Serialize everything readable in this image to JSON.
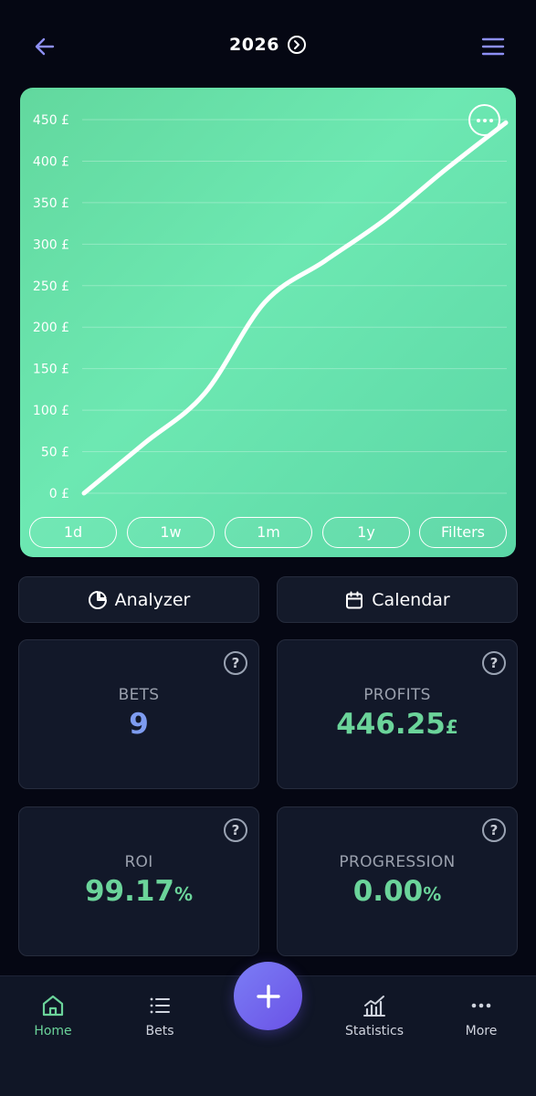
{
  "header": {
    "year": "2026"
  },
  "chart_data": {
    "type": "line",
    "title": "",
    "xlabel": "",
    "ylabel": "",
    "ylim": [
      0,
      450
    ],
    "yticks": [
      "0 £",
      "50 £",
      "100 £",
      "150 £",
      "200 £",
      "250 £",
      "300 £",
      "350 £",
      "400 £",
      "450 £"
    ],
    "grid": true,
    "series": [
      {
        "values": [
          0,
          60,
          120,
          230,
          280,
          330,
          390,
          446.25
        ]
      }
    ]
  },
  "range_buttons": [
    "1d",
    "1w",
    "1m",
    "1y",
    "Filters"
  ],
  "actions": {
    "analyzer": "Analyzer",
    "calendar": "Calendar"
  },
  "stats": {
    "bets": {
      "label": "BETS",
      "value": "9"
    },
    "profits": {
      "label": "PROFITS",
      "value": "446.25",
      "unit": "£"
    },
    "roi": {
      "label": "ROI",
      "value": "99.17",
      "unit": "%"
    },
    "progression": {
      "label": "PROGRESSION",
      "value": "0.00",
      "unit": "%"
    }
  },
  "nav": {
    "home": "Home",
    "bets": "Bets",
    "statistics": "Statistics",
    "more": "More"
  },
  "colors": {
    "accent_green": "#6bd49a",
    "accent_blue": "#7e9cf0",
    "fab": "#6a52e6"
  }
}
